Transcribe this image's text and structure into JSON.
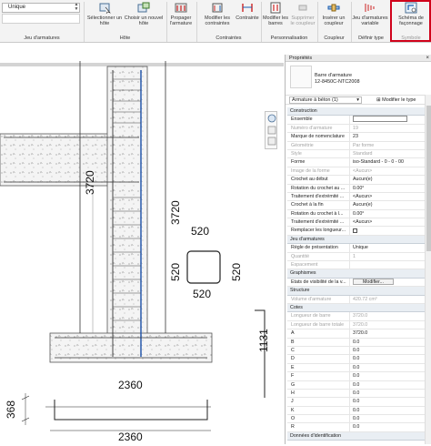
{
  "ribbon": {
    "dropdown_value": "Unique",
    "buttons": [
      {
        "label": "Sélectionner un hôte",
        "icon": "host-select-icon"
      },
      {
        "label": "Choisir un nouvel hôte",
        "icon": "new-host-icon"
      },
      {
        "label": "Propager l'armature",
        "icon": "propagate-icon"
      },
      {
        "label": "Modifier les contraintes",
        "icon": "edit-constraints-icon"
      },
      {
        "label": "Contrainte",
        "icon": "constraint-icon"
      },
      {
        "label": "Modifier les barres",
        "icon": "modify-bars-icon"
      },
      {
        "label": "Supprimer le coupleur",
        "icon": "delete-coupler-icon"
      },
      {
        "label": "Insérer un coupleur",
        "icon": "insert-coupler-icon"
      },
      {
        "label": "Jeu d'armatures variable",
        "icon": "variable-set-icon"
      },
      {
        "label": "Schéma de façonnage",
        "icon": "shape-schema-icon"
      }
    ],
    "groups": [
      "Jeu d'armatures",
      "Hôte",
      "Contraintes",
      "Personnalisation",
      "Coupleur",
      "Définir type",
      "Symbole"
    ]
  },
  "properties": {
    "title": "Propriétés",
    "close": "×",
    "type_name_1": "Barre d'armature",
    "type_name_2": "12-8450C-NTC2008",
    "type_selector": "Armature à béton (1)",
    "edit_type": "Modifier le type",
    "rows": [
      {
        "kind": "cat",
        "k": "Construction"
      },
      {
        "kind": "input",
        "k": "Ensemble",
        "v": ""
      },
      {
        "kind": "grey",
        "k": "Numéro d'armature",
        "v": "19"
      },
      {
        "kind": "norm",
        "k": "Marque de nomenclature",
        "v": "23"
      },
      {
        "kind": "grey",
        "k": "Géométrie",
        "v": "Par forme"
      },
      {
        "kind": "grey",
        "k": "Style",
        "v": "Standard"
      },
      {
        "kind": "norm",
        "k": "Forme",
        "v": "iso-Standard - 0 - 0 - 00"
      },
      {
        "kind": "grey",
        "k": "Image de la forme",
        "v": "<Aucun>"
      },
      {
        "kind": "norm",
        "k": "Crochet au début",
        "v": "Aucun(e)"
      },
      {
        "kind": "norm",
        "k": "Rotation du crochet au ...",
        "v": "0.00°"
      },
      {
        "kind": "norm",
        "k": "Traitement d'extrémité ...",
        "v": "<Aucun>"
      },
      {
        "kind": "norm",
        "k": "Crochet à la fin",
        "v": "Aucun(e)"
      },
      {
        "kind": "norm",
        "k": "Rotation du crochet à l...",
        "v": "0.00°"
      },
      {
        "kind": "norm",
        "k": "Traitement d'extrémité ...",
        "v": "<Aucun>"
      },
      {
        "kind": "check",
        "k": "Remplacer les longueur..."
      },
      {
        "kind": "cat",
        "k": "Jeu d'armatures"
      },
      {
        "kind": "norm",
        "k": "Règle de présentation",
        "v": "Unique"
      },
      {
        "kind": "grey",
        "k": "Quantité",
        "v": "1"
      },
      {
        "kind": "grey",
        "k": "Espacement",
        "v": ""
      },
      {
        "kind": "cat",
        "k": "Graphismes"
      },
      {
        "kind": "button",
        "k": "Etats de visibilité de la v...",
        "v": "Modifier..."
      },
      {
        "kind": "cat",
        "k": "Structure"
      },
      {
        "kind": "grey",
        "k": "Volume d'armature",
        "v": "420.72 cm³"
      },
      {
        "kind": "cat",
        "k": "Cotes"
      },
      {
        "kind": "grey",
        "k": "Longueur de barre",
        "v": "3720.0"
      },
      {
        "kind": "grey",
        "k": "Longueur de barre totale",
        "v": "3720.0"
      },
      {
        "kind": "norm",
        "k": "A",
        "v": "3720.0"
      },
      {
        "kind": "norm",
        "k": "B",
        "v": "0.0"
      },
      {
        "kind": "norm",
        "k": "C",
        "v": "0.0"
      },
      {
        "kind": "norm",
        "k": "D",
        "v": "0.0"
      },
      {
        "kind": "norm",
        "k": "E",
        "v": "0.0"
      },
      {
        "kind": "norm",
        "k": "F",
        "v": "0.0"
      },
      {
        "kind": "norm",
        "k": "G",
        "v": "0.0"
      },
      {
        "kind": "norm",
        "k": "H",
        "v": "0.0"
      },
      {
        "kind": "norm",
        "k": "J",
        "v": "0.0"
      },
      {
        "kind": "norm",
        "k": "K",
        "v": "0.0"
      },
      {
        "kind": "norm",
        "k": "O",
        "v": "0.0"
      },
      {
        "kind": "norm",
        "k": "R",
        "v": "0.0"
      },
      {
        "kind": "cat",
        "k": "Données d'identification"
      }
    ]
  },
  "drawing": {
    "dim_3720_left": "3720",
    "dim_3720_right": "3720",
    "dim_520_top": "520",
    "dim_520_left": "520",
    "dim_520_right": "520",
    "dim_520_bottom": "520",
    "dim_1131": "1131",
    "dim_2360_top": "2360",
    "dim_368": "368",
    "dim_2360_bottom": "2360"
  }
}
